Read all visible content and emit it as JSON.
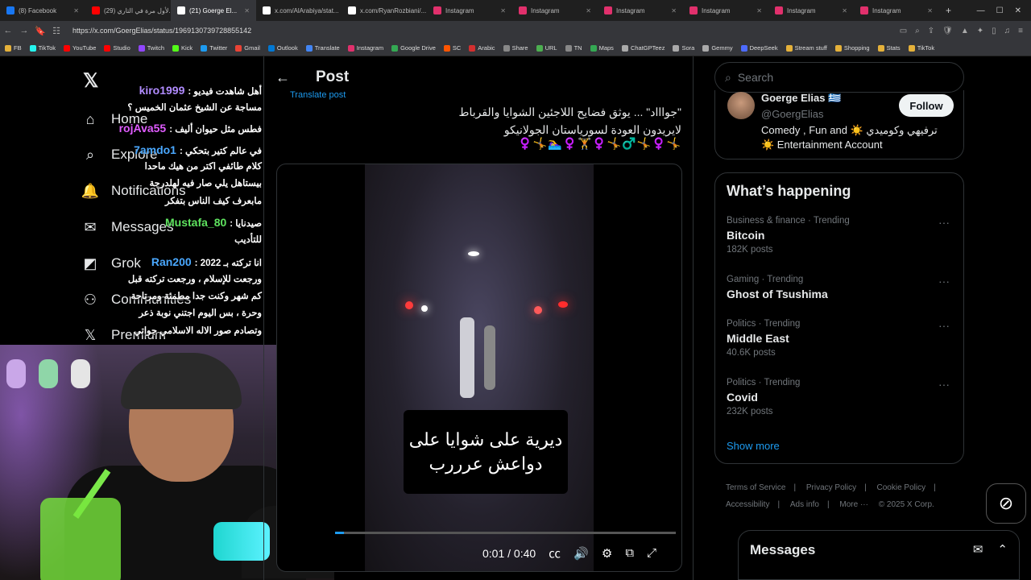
{
  "browser": {
    "tabs": [
      {
        "title": "(8) Facebook",
        "color": "#1877f2"
      },
      {
        "title": "(29) لأول مرة في التاري...",
        "color": "#ff0000"
      },
      {
        "title": "(21) Goerge El...",
        "color": "#ffffff",
        "active": true
      },
      {
        "title": "x.com/AlArabiya/stat...",
        "color": "#ffffff"
      },
      {
        "title": "x.com/RyanRozbiani/...",
        "color": "#ffffff"
      },
      {
        "title": "Instagram",
        "color": "#e1306c"
      },
      {
        "title": "Instagram",
        "color": "#e1306c"
      },
      {
        "title": "Instagram",
        "color": "#e1306c"
      },
      {
        "title": "Instagram",
        "color": "#e1306c"
      },
      {
        "title": "Instagram",
        "color": "#e1306c"
      },
      {
        "title": "Instagram",
        "color": "#e1306c"
      }
    ],
    "url": "https://x.com/GoergElias/status/1969130739728855142",
    "bookmarks": [
      {
        "label": "FB",
        "color": "#e5b13a"
      },
      {
        "label": "TikTok",
        "color": "#25f4ee"
      },
      {
        "label": "YouTube",
        "color": "#ff0000"
      },
      {
        "label": "Studio",
        "color": "#ff0000"
      },
      {
        "label": "Twitch",
        "color": "#9146ff"
      },
      {
        "label": "Kick",
        "color": "#53fc18"
      },
      {
        "label": "Twitter",
        "color": "#1d9bf0"
      },
      {
        "label": "Gmail",
        "color": "#ea4335"
      },
      {
        "label": "Outlook",
        "color": "#0078d4"
      },
      {
        "label": "Translate",
        "color": "#4285f4"
      },
      {
        "label": "Instagram",
        "color": "#e1306c"
      },
      {
        "label": "Google Drive",
        "color": "#34a853"
      },
      {
        "label": "SC",
        "color": "#ff5500"
      },
      {
        "label": "Arabic",
        "color": "#d32f2f"
      },
      {
        "label": "Share",
        "color": "#888888"
      },
      {
        "label": "URL",
        "color": "#4caf50"
      },
      {
        "label": "TN",
        "color": "#888888"
      },
      {
        "label": "Maps",
        "color": "#34a853"
      },
      {
        "label": "ChatGPTeez",
        "color": "#aaaaaa"
      },
      {
        "label": "Sora",
        "color": "#aaaaaa"
      },
      {
        "label": "Gemmy",
        "color": "#aaaaaa"
      },
      {
        "label": "DeepSeek",
        "color": "#4d6bfe"
      },
      {
        "label": "Stream stuff",
        "color": "#e5b13a"
      },
      {
        "label": "Shopping",
        "color": "#e5b13a"
      },
      {
        "label": "Stats",
        "color": "#e5b13a"
      },
      {
        "label": "TikTok",
        "color": "#e5b13a"
      }
    ]
  },
  "nav": {
    "items": [
      "Home",
      "Explore",
      "Notifications",
      "Messages",
      "Grok",
      "Communities",
      "Premium"
    ]
  },
  "chat": [
    {
      "user": "kiro1999",
      "color": "#b18cff",
      "text": "أهل شاهدت فيديو :"
    },
    {
      "user": "",
      "color": "#ffffff",
      "text": "مساجة عن الشيخ عثمان الخميس ؟"
    },
    {
      "user": "rojAva55",
      "color": "#e05cff",
      "text": "فطس مثل حيوان أليف :"
    },
    {
      "user": "7amdo1",
      "color": "#4aa8ff",
      "text": "في عالم كتير بتحكي :"
    },
    {
      "user": "",
      "color": "#ffffff",
      "text": "كلام طائفي اكتر من هيك ماحدا"
    },
    {
      "user": "",
      "color": "#ffffff",
      "text": "بيستاهل يلي صار فيه لهلدرجة"
    },
    {
      "user": "",
      "color": "#ffffff",
      "text": "مابعرف كيف الناس بتفكر"
    },
    {
      "user": "Mustafa_80",
      "color": "#5fe35f",
      "text": "صيدنايا :"
    },
    {
      "user": "",
      "color": "#ffffff",
      "text": "للتأديب"
    },
    {
      "user": "Ran200",
      "color": "#4aa8ff",
      "text": "انا تركته بـ 2022 :"
    },
    {
      "user": "",
      "color": "#ffffff",
      "text": "ورجعت للإسلام ، ورجعت تركته قبل"
    },
    {
      "user": "",
      "color": "#ffffff",
      "text": "كم شهر وكنت جدا مطمئة ومرتاحة"
    },
    {
      "user": "",
      "color": "#ffffff",
      "text": "وحرة ، بس اليوم اجتني نوبة ذعر"
    },
    {
      "user": "",
      "color": "#ffffff",
      "text": "وتصادم صور الاله الاسلامي جواتي"
    }
  ],
  "post": {
    "header": "Post",
    "translate_label": "Translate post",
    "text_line1": "\"جواااد\" ... يوثق فضايح اللاجئين الشوايا والقرباط",
    "text_line2": "لايريدون العودة لسورياستان الجولانيكو",
    "emoji_row": "♀️🤸🏊‍♀️♀️🏋️♀️🤸♂️🤸♀️🤸",
    "video_caption": "ديرية على شوايا على دواعش عرررب",
    "video_time": "0:01 / 0:40",
    "progress": 0.025
  },
  "sidebar": {
    "search_placeholder": "Search",
    "profile": {
      "name": "Goerge Elias",
      "handle": "@GoergElias",
      "follow": "Follow",
      "bio_line1": "Comedy , Fun and ☀️ ترفيهي وكوميدي",
      "bio_line2": "☀️ Entertainment Account"
    },
    "happening_title": "What’s happening",
    "trends": [
      {
        "category": "Business & finance · Trending",
        "name": "Bitcoin",
        "posts": "182K posts"
      },
      {
        "category": "Gaming · Trending",
        "name": "Ghost of Tsushima",
        "posts": ""
      },
      {
        "category": "Politics · Trending",
        "name": "Middle East",
        "posts": "40.6K posts"
      },
      {
        "category": "Politics · Trending",
        "name": "Covid",
        "posts": "232K posts"
      }
    ],
    "show_more": "Show more",
    "footer": [
      "Terms of Service",
      "Privacy Policy",
      "Cookie Policy",
      "Accessibility",
      "Ads info",
      "More ···",
      "© 2025 X Corp."
    ],
    "messages_title": "Messages"
  }
}
